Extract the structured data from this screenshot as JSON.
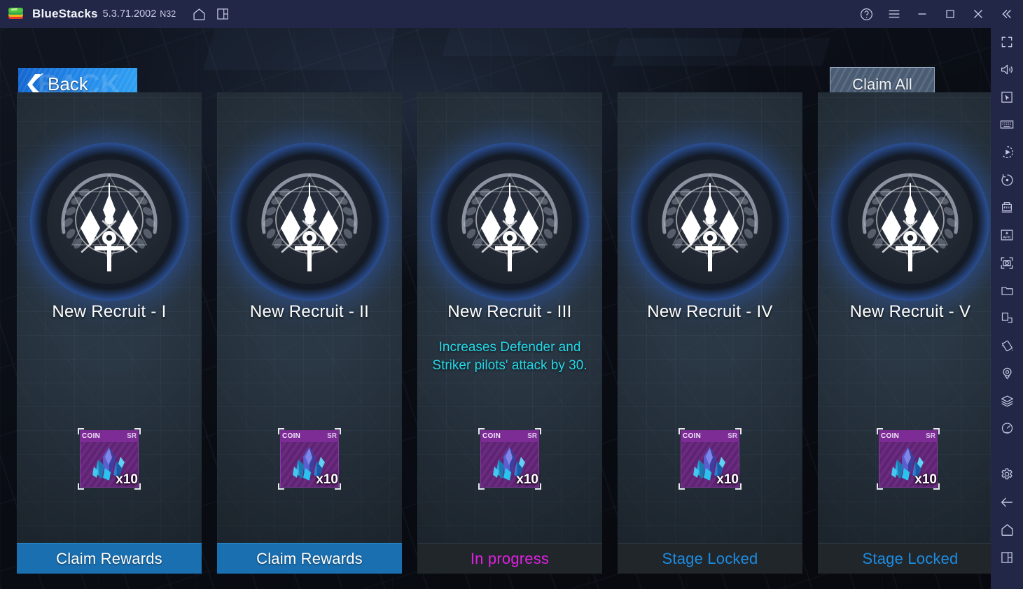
{
  "titlebar": {
    "app_name": "BlueStacks",
    "version": "5.3.71.2002",
    "instance": "N32",
    "left_icons": [
      {
        "name": "home-icon",
        "label": "Home"
      },
      {
        "name": "multi-instance-icon",
        "label": "Multi-instance"
      }
    ],
    "right_icons": [
      {
        "name": "help-icon",
        "label": "Help"
      },
      {
        "name": "menu-icon",
        "label": "Menu"
      },
      {
        "name": "minimize-icon",
        "label": "Minimize"
      },
      {
        "name": "maximize-icon",
        "label": "Maximize"
      },
      {
        "name": "close-icon",
        "label": "Close"
      },
      {
        "name": "collapse-sidebar-icon",
        "label": "Collapse"
      }
    ]
  },
  "sidebar": {
    "items": [
      {
        "name": "fullscreen-icon",
        "label": "Fullscreen"
      },
      {
        "name": "volume-icon",
        "label": "Volume"
      },
      {
        "name": "cursor-controls-icon",
        "label": "Game controls"
      },
      {
        "name": "keyboard-icon",
        "label": "Keymapping"
      },
      {
        "name": "macro-record-icon",
        "label": "Macro recorder"
      },
      {
        "name": "rotate-icon",
        "label": "Rotate"
      },
      {
        "name": "multi-instance-manager-icon",
        "label": "Instance manager"
      },
      {
        "name": "install-apk-icon",
        "label": "Install APK"
      },
      {
        "name": "screenshot-icon",
        "label": "Screenshot"
      },
      {
        "name": "media-folder-icon",
        "label": "Media manager"
      },
      {
        "name": "share-screen-icon",
        "label": "Screen share"
      },
      {
        "name": "shake-icon",
        "label": "Shake"
      },
      {
        "name": "location-icon",
        "label": "Location"
      },
      {
        "name": "layers-icon",
        "label": "Eco mode"
      },
      {
        "name": "performance-icon",
        "label": "Performance"
      },
      {
        "name": "settings-icon",
        "label": "Settings"
      },
      {
        "name": "back-nav-icon",
        "label": "Back"
      },
      {
        "name": "home-nav-icon",
        "label": "Home"
      },
      {
        "name": "recents-nav-icon",
        "label": "Recent apps"
      }
    ]
  },
  "game": {
    "back_button": {
      "label": "Back",
      "watermark": "BACK"
    },
    "claim_all_button": {
      "label": "Claim All"
    },
    "colors": {
      "accent_blue": "#1a6fb0",
      "halo_blue": "#3264c8",
      "desc_cyan": "#25d8e8",
      "in_progress_magenta": "#e020e0",
      "locked_blue": "#1e8ce0",
      "reward_purple": "#7d2c96"
    },
    "cards": [
      {
        "title": "New Recruit - I",
        "description": "",
        "reward": {
          "type": "COIN",
          "rarity": "SR",
          "quantity": "x10",
          "icon": "crystal-icon"
        },
        "action": {
          "label": "Claim Rewards",
          "state": "claim"
        }
      },
      {
        "title": "New Recruit - II",
        "description": "",
        "reward": {
          "type": "COIN",
          "rarity": "SR",
          "quantity": "x10",
          "icon": "crystal-icon"
        },
        "action": {
          "label": "Claim Rewards",
          "state": "claim"
        }
      },
      {
        "title": "New Recruit - III",
        "description": "Increases Defender and Striker pilots' attack by 30.",
        "reward": {
          "type": "COIN",
          "rarity": "SR",
          "quantity": "x10",
          "icon": "crystal-icon"
        },
        "action": {
          "label": "In progress",
          "state": "progress"
        }
      },
      {
        "title": "New Recruit - IV",
        "description": "",
        "reward": {
          "type": "COIN",
          "rarity": "SR",
          "quantity": "x10",
          "icon": "crystal-icon"
        },
        "action": {
          "label": "Stage Locked",
          "state": "locked"
        }
      },
      {
        "title": "New Recruit - V",
        "description": "",
        "reward": {
          "type": "COIN",
          "rarity": "SR",
          "quantity": "x10",
          "icon": "crystal-icon"
        },
        "action": {
          "label": "Stage Locked",
          "state": "locked"
        }
      }
    ]
  }
}
